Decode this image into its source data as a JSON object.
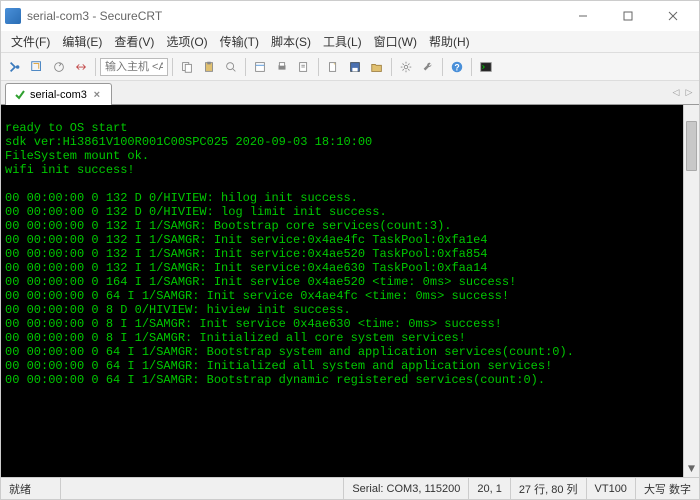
{
  "window": {
    "title": "serial-com3 - SecureCRT"
  },
  "menu": {
    "file": "文件(F)",
    "edit": "编辑(E)",
    "view": "查看(V)",
    "options": "选项(O)",
    "transfer": "传输(T)",
    "script": "脚本(S)",
    "tools": "工具(L)",
    "window": "窗口(W)",
    "help": "帮助(H)"
  },
  "toolbar": {
    "host_placeholder": "输入主机 <Al"
  },
  "tab": {
    "label": "serial-com3"
  },
  "terminal": {
    "lines": [
      "ready to OS start",
      "sdk ver:Hi3861V100R001C00SPC025 2020-09-03 18:10:00",
      "FileSystem mount ok.",
      "wifi init success!",
      "",
      "00 00:00:00 0 132 D 0/HIVIEW: hilog init success.",
      "00 00:00:00 0 132 D 0/HIVIEW: log limit init success.",
      "00 00:00:00 0 132 I 1/SAMGR: Bootstrap core services(count:3).",
      "00 00:00:00 0 132 I 1/SAMGR: Init service:0x4ae4fc TaskPool:0xfa1e4",
      "00 00:00:00 0 132 I 1/SAMGR: Init service:0x4ae520 TaskPool:0xfa854",
      "00 00:00:00 0 132 I 1/SAMGR: Init service:0x4ae630 TaskPool:0xfaa14",
      "00 00:00:00 0 164 I 1/SAMGR: Init service 0x4ae520 <time: 0ms> success!",
      "00 00:00:00 0 64 I 1/SAMGR: Init service 0x4ae4fc <time: 0ms> success!",
      "00 00:00:00 0 8 D 0/HIVIEW: hiview init success.",
      "00 00:00:00 0 8 I 1/SAMGR: Init service 0x4ae630 <time: 0ms> success!",
      "00 00:00:00 0 8 I 1/SAMGR: Initialized all core system services!",
      "00 00:00:00 0 64 I 1/SAMGR: Bootstrap system and application services(count:0).",
      "00 00:00:00 0 64 I 1/SAMGR: Initialized all system and application services!",
      "00 00:00:00 0 64 I 1/SAMGR: Bootstrap dynamic registered services(count:0)."
    ]
  },
  "status": {
    "ready": "就绪",
    "serial": "Serial: COM3, 115200",
    "pos1": "20,   1",
    "pos2": "27 行, 80 列",
    "term": "VT100",
    "caps": "大写 数字"
  }
}
